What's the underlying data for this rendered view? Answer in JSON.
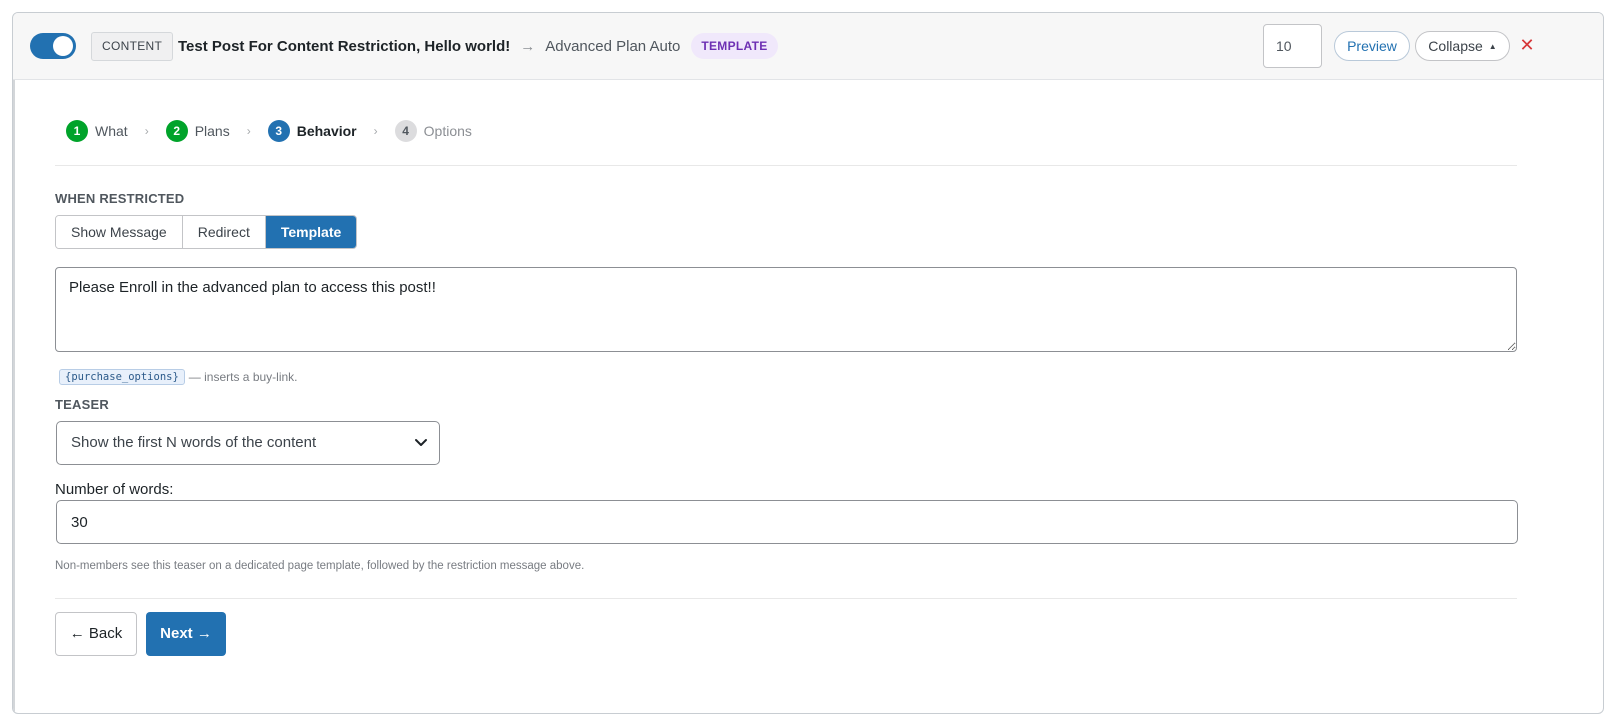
{
  "header": {
    "toggle_state": "on",
    "content_badge": "CONTENT",
    "post_title": "Test Post For Content Restriction, Hello world!",
    "arrow": "→",
    "plan_name": "Advanced Plan Auto",
    "type_badge": "TEMPLATE",
    "order_value": "10",
    "preview_label": "Preview",
    "collapse_label": "Collapse",
    "collapse_caret": "▲",
    "close_glyph": "✕"
  },
  "steps": [
    {
      "num": "1",
      "label": "What",
      "state": "done"
    },
    {
      "num": "2",
      "label": "Plans",
      "state": "done"
    },
    {
      "num": "3",
      "label": "Behavior",
      "state": "active"
    },
    {
      "num": "4",
      "label": "Options",
      "state": "pending"
    }
  ],
  "step_separator": "›",
  "behavior": {
    "when_restricted_label": "WHEN RESTRICTED",
    "modes": [
      "Show Message",
      "Redirect",
      "Template"
    ],
    "active_mode": "Template",
    "message": "Please Enroll in the advanced plan to access this post!!",
    "token": "{purchase_options}",
    "token_desc": "— inserts a buy-link.",
    "teaser_label": "TEASER",
    "teaser_value": "Show the first N words of the content",
    "words_label": "Number of words:",
    "words_value": "30",
    "note": "Non-members see this teaser on a dedicated page template, followed by the restriction message above."
  },
  "nav": {
    "back_label": "← Back",
    "next_label": "Next →"
  },
  "colors": {
    "accent": "#2271b1",
    "success": "#00a32a",
    "danger": "#d63638",
    "template_badge_bg": "#f0e8fb",
    "template_badge_fg": "#6d2fb3"
  }
}
